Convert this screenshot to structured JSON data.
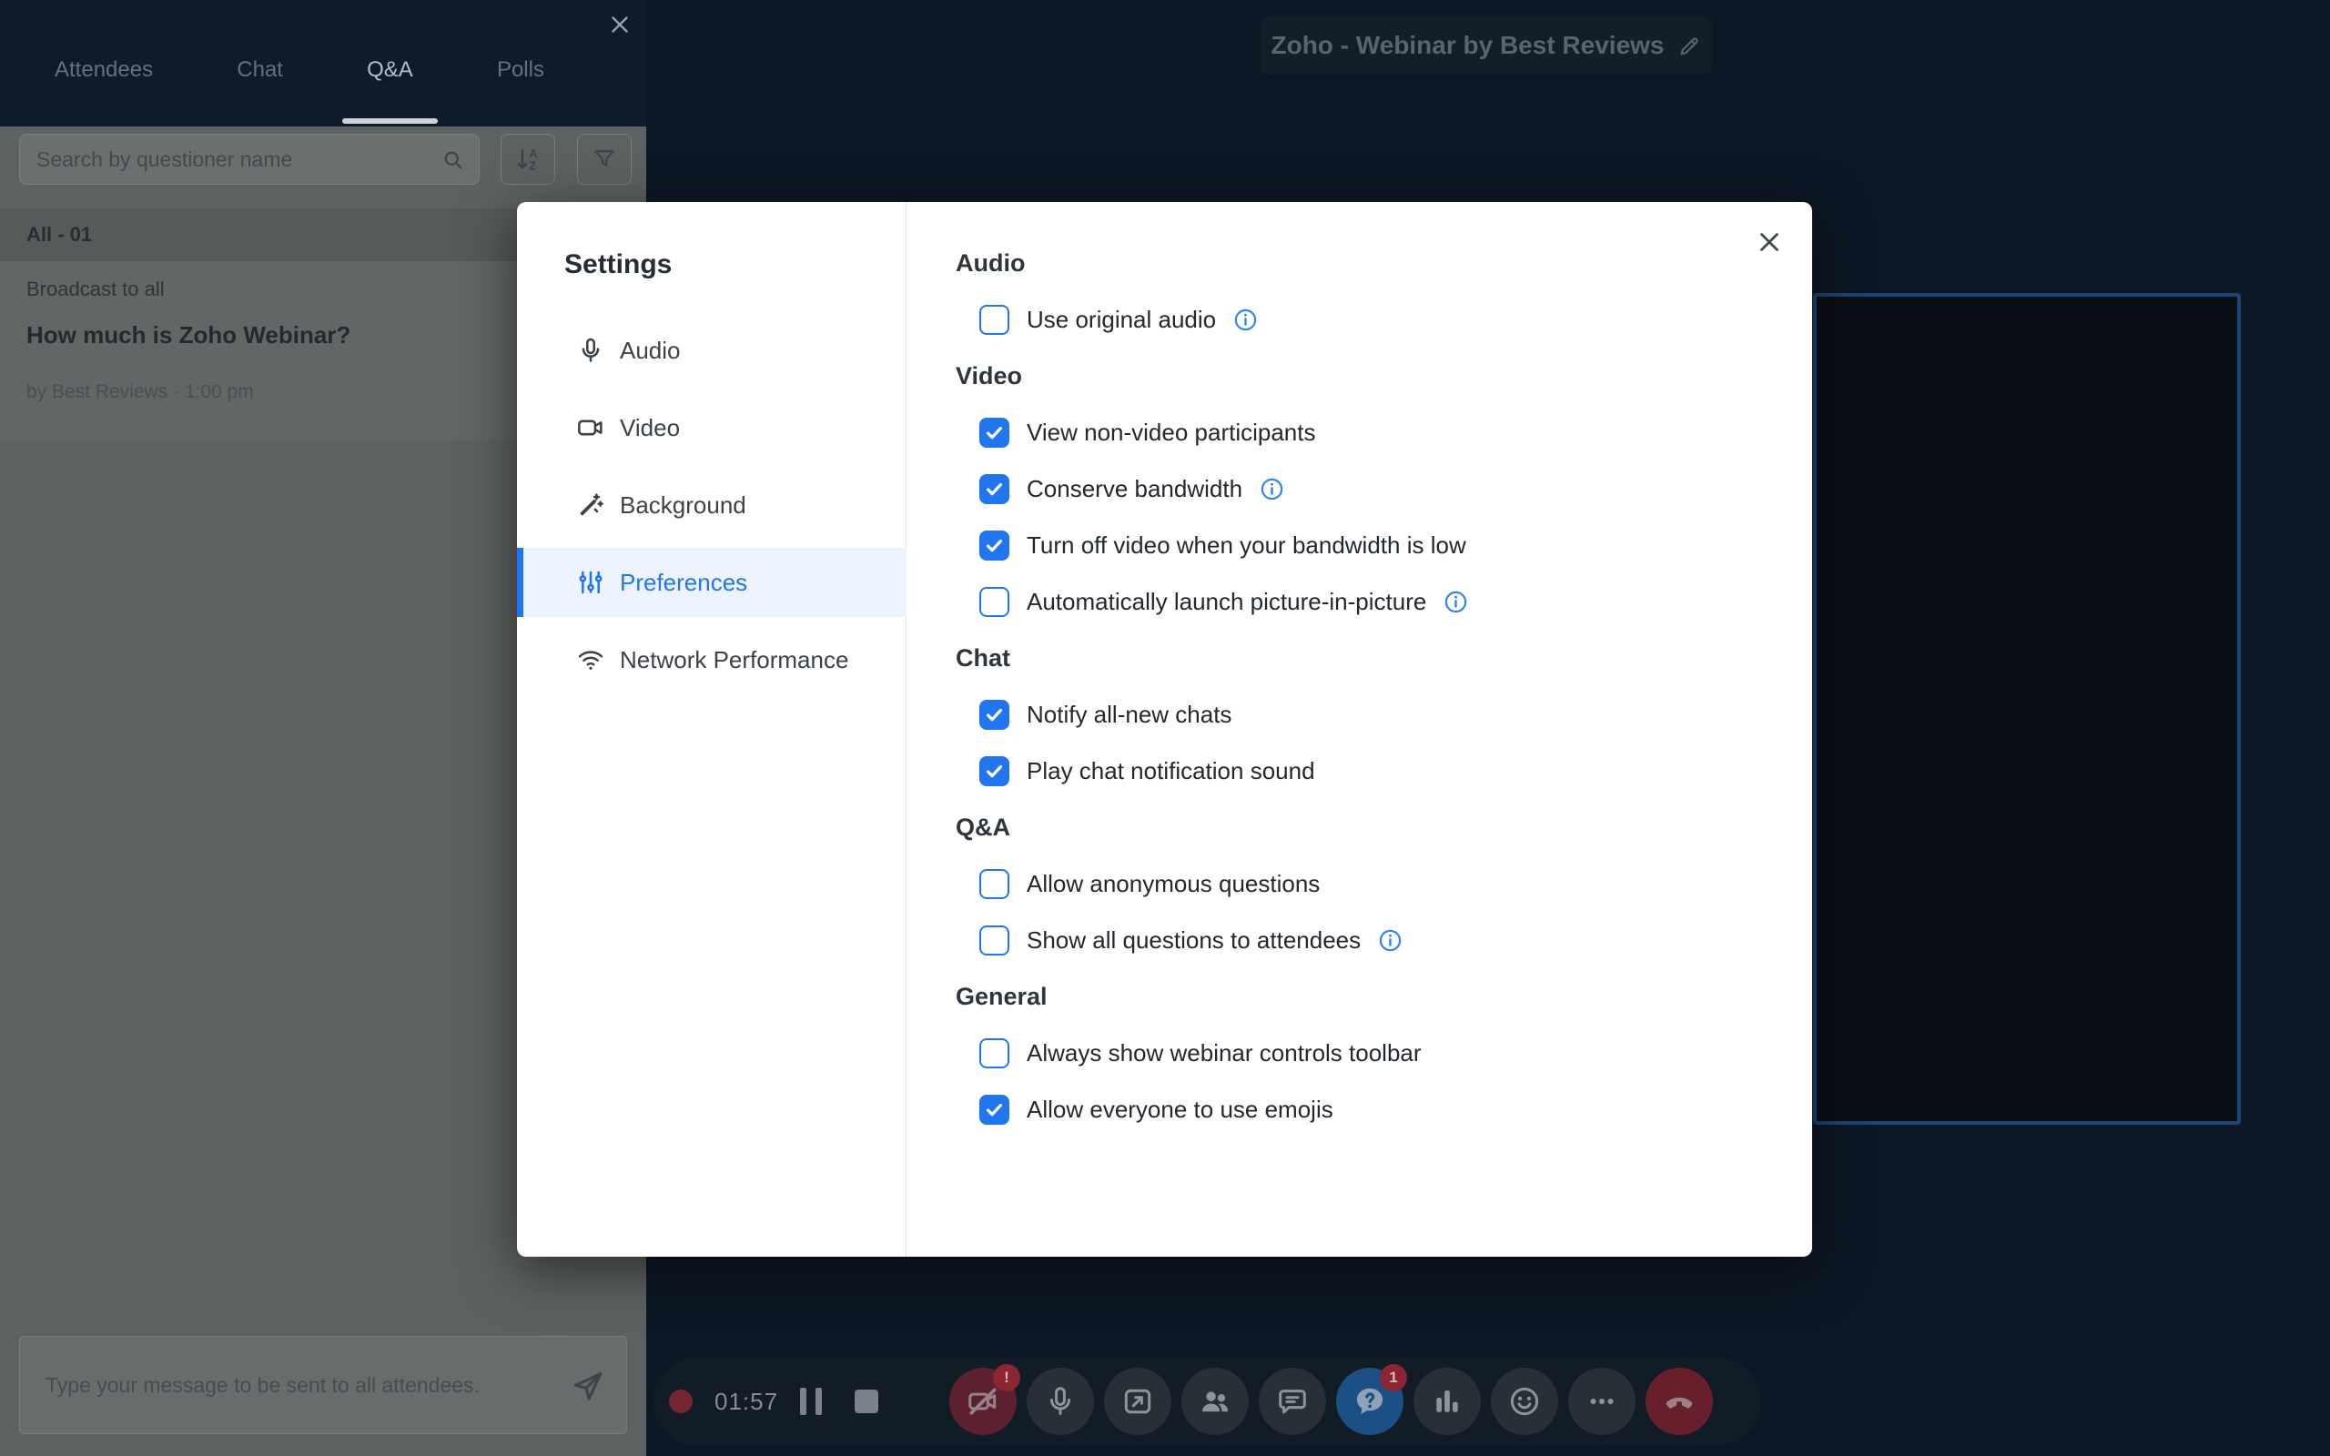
{
  "qa_panel": {
    "tabs": [
      {
        "label": "Attendees",
        "active": false
      },
      {
        "label": "Chat",
        "active": false
      },
      {
        "label": "Q&A",
        "active": true
      },
      {
        "label": "Polls",
        "active": false
      }
    ],
    "search": {
      "placeholder": "Search by questioner name"
    },
    "filter_label": "All - 01",
    "question": {
      "audience": "Broadcast to all",
      "title": "How much is Zoho Webinar?",
      "meta": "by Best Reviews · 1:00 pm"
    },
    "composer": {
      "placeholder": "Type your message to be sent to all attendees."
    }
  },
  "stage": {
    "title": "Zoho - Webinar by Best Reviews"
  },
  "settings_modal": {
    "title": "Settings",
    "nav": [
      {
        "label": "Audio",
        "icon": "microphone-icon",
        "active": false
      },
      {
        "label": "Video",
        "icon": "video-camera-icon",
        "active": false
      },
      {
        "label": "Background",
        "icon": "magic-wand-icon",
        "active": false
      },
      {
        "label": "Preferences",
        "icon": "sliders-icon",
        "active": true
      },
      {
        "label": "Network Performance",
        "icon": "wifi-icon",
        "active": false
      }
    ],
    "sections": [
      {
        "heading": "Audio",
        "options": [
          {
            "label": "Use original audio",
            "checked": false,
            "info": true
          }
        ]
      },
      {
        "heading": "Video",
        "options": [
          {
            "label": "View non-video participants",
            "checked": true,
            "info": false
          },
          {
            "label": "Conserve bandwidth",
            "checked": true,
            "info": true
          },
          {
            "label": "Turn off video when your bandwidth is low",
            "checked": true,
            "info": false
          },
          {
            "label": "Automatically launch picture-in-picture",
            "checked": false,
            "info": true
          }
        ]
      },
      {
        "heading": "Chat",
        "options": [
          {
            "label": "Notify all-new chats",
            "checked": true,
            "info": false
          },
          {
            "label": "Play chat notification sound",
            "checked": true,
            "info": false
          }
        ]
      },
      {
        "heading": "Q&A",
        "options": [
          {
            "label": "Allow anonymous questions",
            "checked": false,
            "info": false
          },
          {
            "label": "Show all questions to attendees",
            "checked": false,
            "info": true
          }
        ]
      },
      {
        "heading": "General",
        "options": [
          {
            "label": "Always show webinar controls toolbar",
            "checked": false,
            "info": false
          },
          {
            "label": "Allow everyone to use emojis",
            "checked": true,
            "info": false
          }
        ]
      }
    ]
  },
  "toolbar": {
    "timer": "01:57",
    "buttons": [
      {
        "id": "camera",
        "icon": "camera-off-icon",
        "variant": "camera-alert",
        "badge": "!"
      },
      {
        "id": "microphone",
        "icon": "microphone-icon",
        "variant": "default",
        "badge": null
      },
      {
        "id": "share-screen",
        "icon": "share-screen-icon",
        "variant": "default",
        "badge": null
      },
      {
        "id": "participants",
        "icon": "participants-icon",
        "variant": "default",
        "badge": null
      },
      {
        "id": "chat",
        "icon": "chat-bubble-icon",
        "variant": "default",
        "badge": null
      },
      {
        "id": "qna",
        "icon": "question-bubble-icon",
        "variant": "primary",
        "badge": "1"
      },
      {
        "id": "polls",
        "icon": "bar-chart-icon",
        "variant": "default",
        "badge": null
      },
      {
        "id": "reactions",
        "icon": "smiley-icon",
        "variant": "default",
        "badge": null
      },
      {
        "id": "more",
        "icon": "more-dots-icon",
        "variant": "default",
        "badge": null
      },
      {
        "id": "end-call",
        "icon": "end-call-icon",
        "variant": "end",
        "badge": null
      }
    ]
  },
  "colors": {
    "accent_blue": "#2176f0",
    "active_nav_bg": "#edf3fd",
    "qna_button_blue": "#1c4f83",
    "record_red": "#75252f",
    "camera_alert_red": "#5c2130",
    "end_call_red": "#67202b",
    "badge_red": "#8c2532",
    "video_border_blue": "#1d4672"
  }
}
